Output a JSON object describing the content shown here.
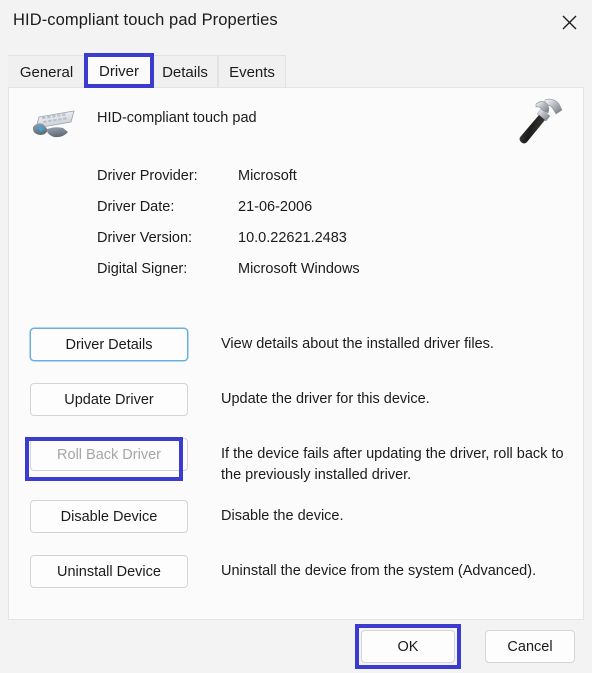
{
  "window": {
    "title": "HID-compliant touch pad Properties",
    "close_icon": "close-icon"
  },
  "tabs": [
    {
      "label": "General",
      "selected": false
    },
    {
      "label": "Driver",
      "selected": true
    },
    {
      "label": "Details",
      "selected": false
    },
    {
      "label": "Events",
      "selected": false
    }
  ],
  "device": {
    "name": "HID-compliant touch pad",
    "device_icon": "hid-touchpad-icon",
    "tool_icon": "hammer-icon"
  },
  "driver_info": [
    {
      "label": "Driver Provider:",
      "value": "Microsoft"
    },
    {
      "label": "Driver Date:",
      "value": "21-06-2006"
    },
    {
      "label": "Driver Version:",
      "value": "10.0.22621.2483"
    },
    {
      "label": "Digital Signer:",
      "value": "Microsoft Windows"
    }
  ],
  "actions": [
    {
      "label": "Driver Details",
      "description": "View details about the installed driver files.",
      "state": "focused"
    },
    {
      "label": "Update Driver",
      "description": "Update the driver for this device.",
      "state": "normal"
    },
    {
      "label": "Roll Back Driver",
      "description": "If the device fails after updating the driver, roll back to the previously installed driver.",
      "state": "disabled"
    },
    {
      "label": "Disable Device",
      "description": "Disable the device.",
      "state": "normal"
    },
    {
      "label": "Uninstall Device",
      "description": "Uninstall the device from the system (Advanced).",
      "state": "normal"
    }
  ],
  "footer": {
    "ok_label": "OK",
    "cancel_label": "Cancel"
  },
  "annotations": {
    "color": "#3b3bcd",
    "targets": [
      "Driver",
      "Roll Back Driver",
      "OK"
    ]
  },
  "colors": {
    "dialog_background": "#f3f3f3",
    "panel_background": "#fbfbfb",
    "text": "#1b1b1b",
    "disabled_text": "#a6a6a6",
    "focus_border": "#69b0e0",
    "annotation_blue": "#3b3bcd"
  }
}
